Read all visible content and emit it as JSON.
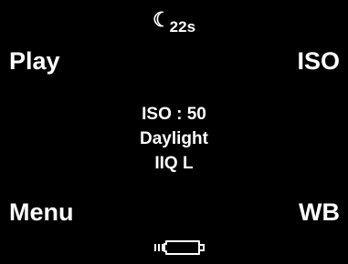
{
  "softkeys": {
    "top_left": "Play",
    "top_right": "ISO",
    "bottom_left": "Menu",
    "bottom_right": "WB"
  },
  "timer": {
    "icon": "moon-icon",
    "value": "22s"
  },
  "settings": {
    "iso": "ISO : 50",
    "white_balance": "Daylight",
    "file_format": "IIQ L"
  },
  "status": {
    "battery_icon": "battery-icon"
  },
  "colors": {
    "background": "#000000",
    "foreground": "#ffffff"
  }
}
